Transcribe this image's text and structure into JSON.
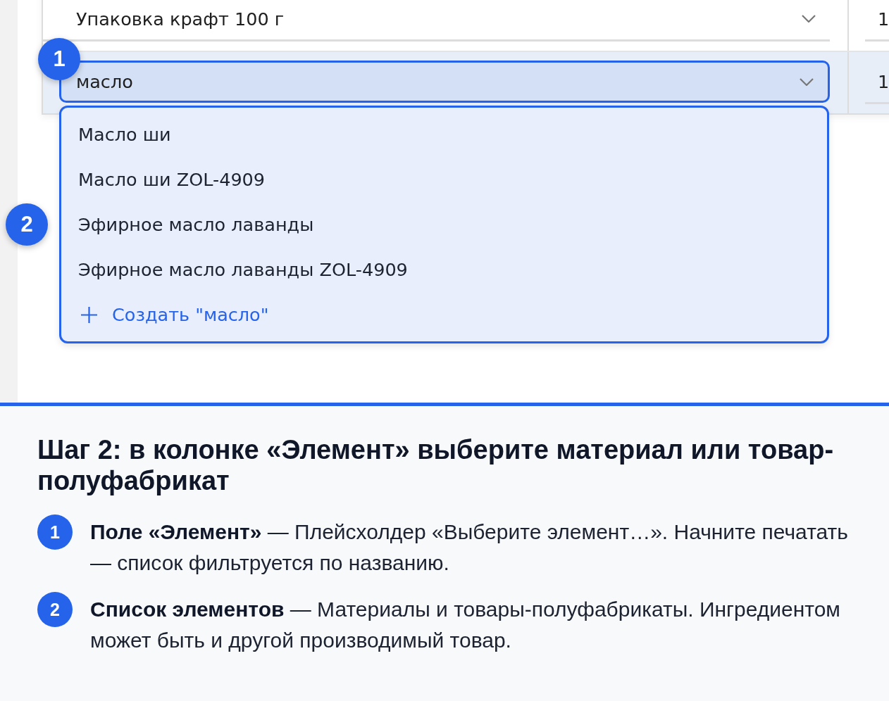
{
  "table": {
    "rows": [
      {
        "selected": false,
        "element": {
          "value": "Упаковка крафт 100 г",
          "focused": false
        },
        "column_2": "1"
      },
      {
        "selected": true,
        "element": {
          "value": "масло",
          "focused": true,
          "callout": "1"
        },
        "column_2": "1"
      }
    ]
  },
  "dropdown": {
    "callout": "2",
    "options": [
      {
        "label": "Масло ши"
      },
      {
        "label": "Масло ши ZOL-4909"
      },
      {
        "label": "Эфирное масло лаванды"
      },
      {
        "label": "Эфирное масло лаванды ZOL-4909"
      }
    ],
    "create_option": {
      "label": "Создать \"масло\""
    }
  },
  "panel": {
    "title": "Шаг 2: в колонке «Элемент» выберите материал или товар-полуфабрикат",
    "steps": [
      {
        "number": "1",
        "text": "**Поле «Элемент»** — Плейсхолдер «Выберите элемент…». Начните печатать — список фильтруется по названию."
      },
      {
        "number": "2",
        "text": "**Список элементов** — Материалы и товары-полуфабрикаты. Ингредиентом может быть и другой производимый товар."
      }
    ]
  }
}
